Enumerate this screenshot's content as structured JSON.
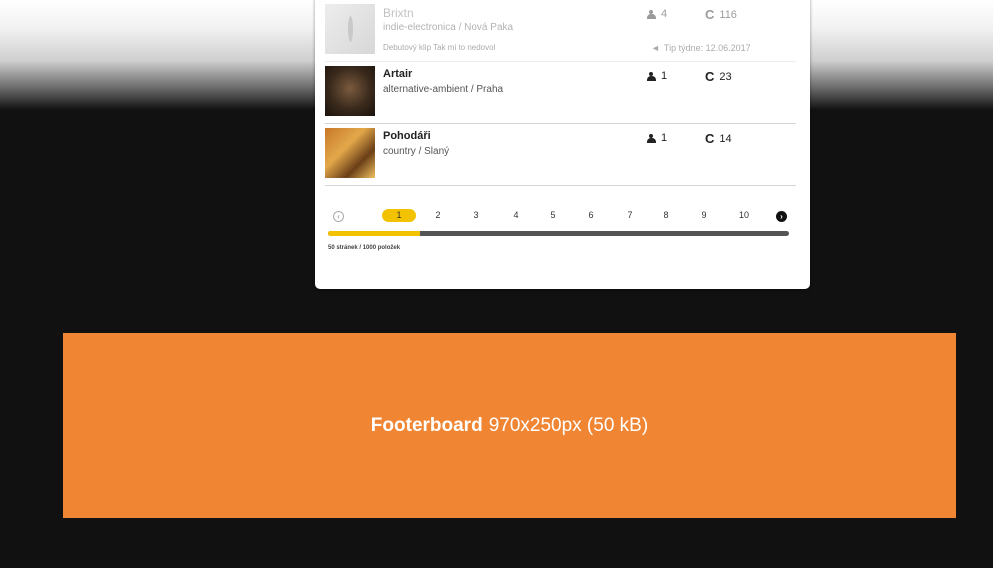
{
  "list": {
    "items": [
      {
        "title": "Brixtn",
        "genre": "indie-electronica / Nová Paka",
        "note": "Debutový klip Tak mi to nedovol",
        "members": "4",
        "plays": "116",
        "tip": "Tip týdne: 12.06.2017",
        "thumb_icon": "feather-icon"
      },
      {
        "title": "Artair",
        "genre": "alternative-ambient / Praha",
        "members": "1",
        "plays": "23"
      },
      {
        "title": "Pohodáři",
        "genre": "country / Slaný",
        "members": "1",
        "plays": "14"
      }
    ],
    "pagination": {
      "pages": [
        "1",
        "2",
        "3",
        "4",
        "5",
        "6",
        "7",
        "8",
        "9",
        "10"
      ],
      "current": "1",
      "progress_fraction": 0.2,
      "summary": "50 stránek / 1000 položek",
      "prev_icon": "chevron-left-icon",
      "next_icon": "chevron-right-icon"
    },
    "icons": {
      "members": "person-icon",
      "plays": "refresh-icon",
      "tip": "megaphone-icon"
    },
    "accent_color": "#f2c200"
  },
  "ad": {
    "label_bold": "Footerboard",
    "label_rest": "970x250px (50 kB)",
    "background_color": "#f08634"
  }
}
